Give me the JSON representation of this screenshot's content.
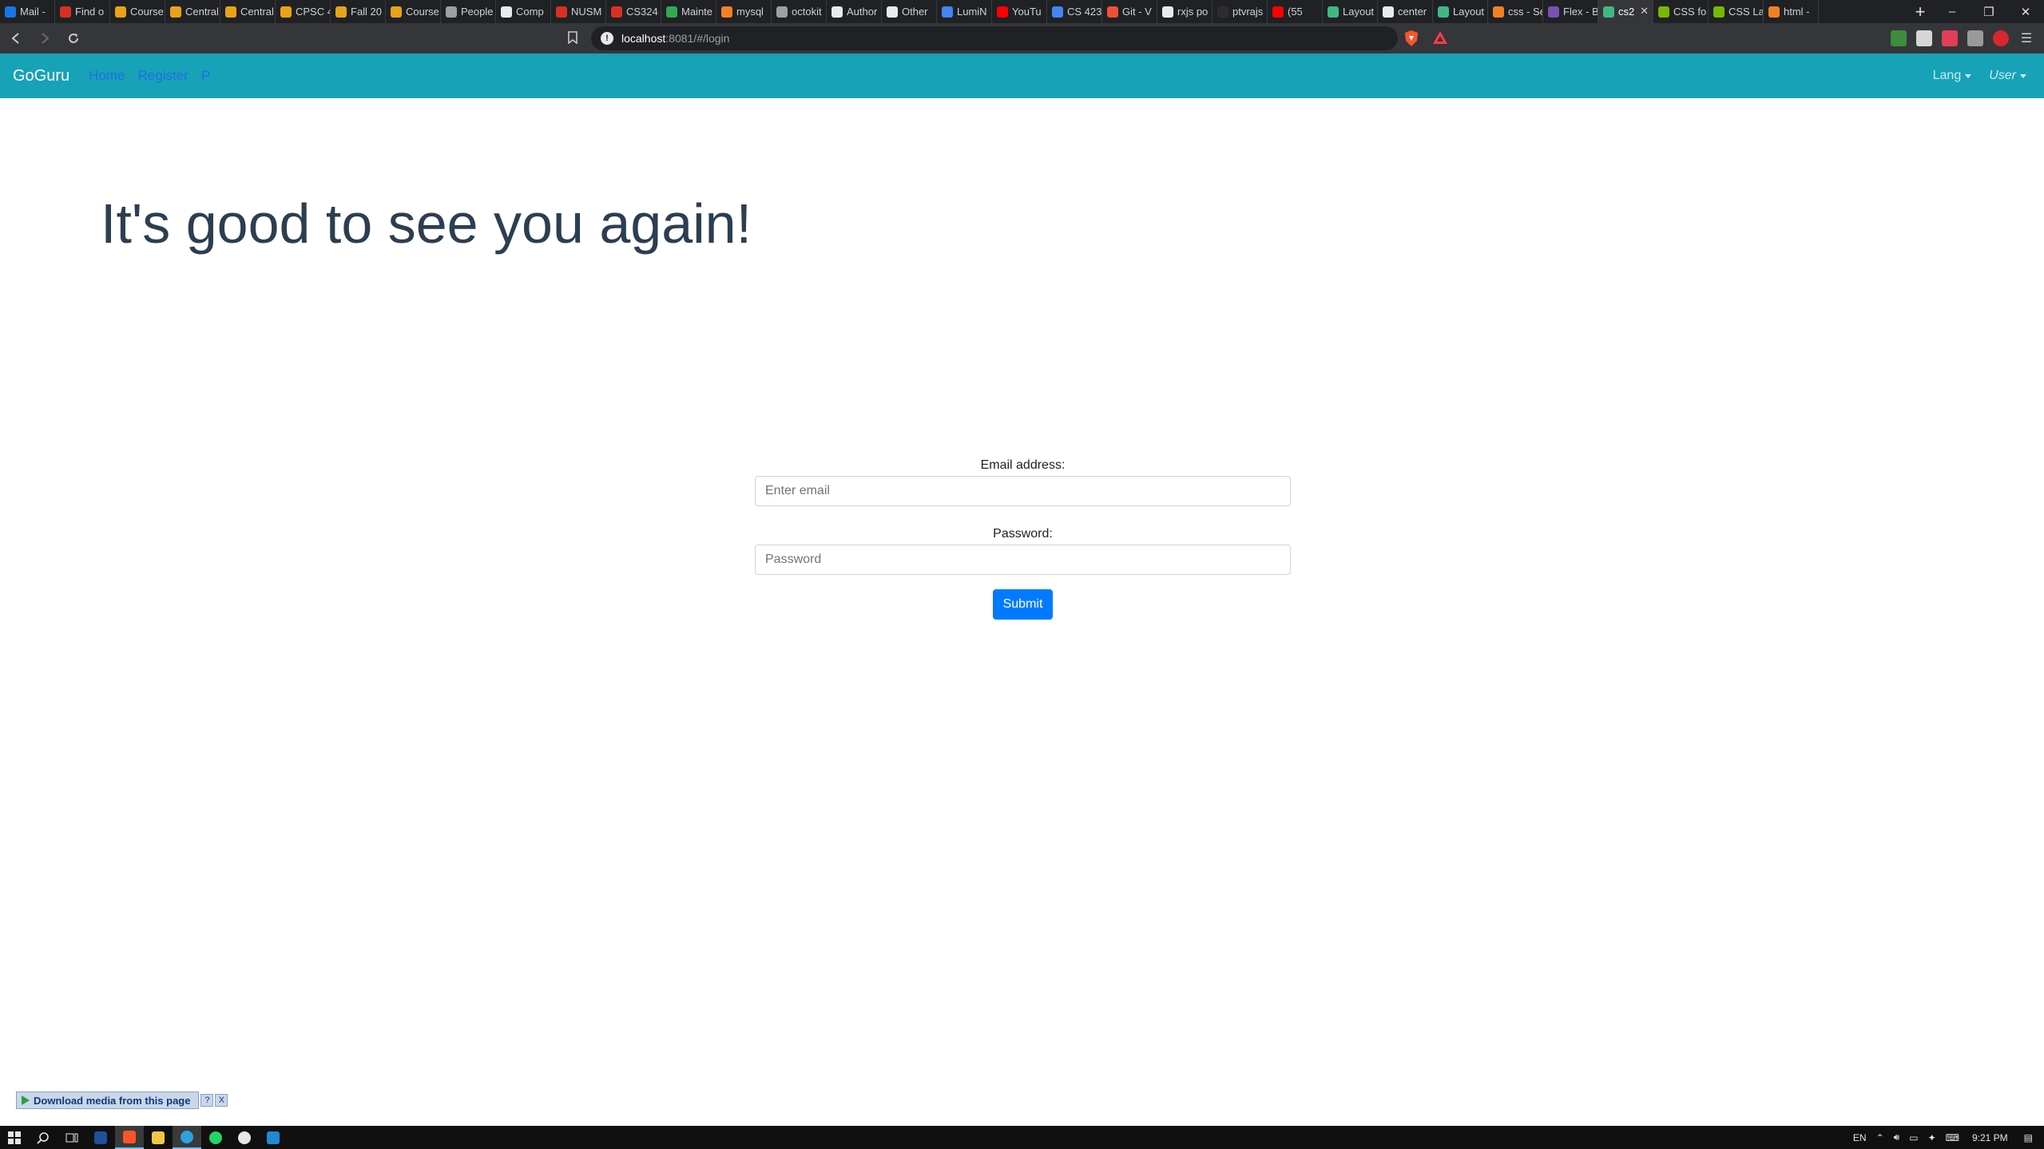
{
  "browser": {
    "tabs": [
      {
        "label": "Mail -",
        "color": "#1a73e8"
      },
      {
        "label": "Find o",
        "color": "#d93025"
      },
      {
        "label": "Course",
        "color": "#e8a317"
      },
      {
        "label": "Central",
        "color": "#e8a317"
      },
      {
        "label": "Central",
        "color": "#e8a317"
      },
      {
        "label": "CPSC 4",
        "color": "#e8a317"
      },
      {
        "label": "Fall 20",
        "color": "#e8a317"
      },
      {
        "label": "Course",
        "color": "#e8a317"
      },
      {
        "label": "People",
        "color": "#9aa0a6"
      },
      {
        "label": "Comp",
        "color": "#e8eaed"
      },
      {
        "label": "NUSM",
        "color": "#d93025"
      },
      {
        "label": "CS324",
        "color": "#d93025"
      },
      {
        "label": "Mainte",
        "color": "#34a853"
      },
      {
        "label": "mysql",
        "color": "#f48024"
      },
      {
        "label": "octokit",
        "color": "#9aa0a6"
      },
      {
        "label": "Author",
        "color": "#e8eaed"
      },
      {
        "label": "Other",
        "color": "#e8eaed"
      },
      {
        "label": "LumiN",
        "color": "#4285f4"
      },
      {
        "label": "YouTu",
        "color": "#ff0000"
      },
      {
        "label": "CS 423",
        "color": "#4285f4"
      },
      {
        "label": "Git - V",
        "color": "#f05133"
      },
      {
        "label": "rxjs po",
        "color": "#e8eaed"
      },
      {
        "label": "ptvrajs",
        "color": "#2d2d2d"
      },
      {
        "label": "(55",
        "color": "#ff0000"
      },
      {
        "label": "Layout",
        "color": "#41b883"
      },
      {
        "label": "center",
        "color": "#e8eaed"
      },
      {
        "label": "Layout",
        "color": "#41b883"
      },
      {
        "label": "css - Se",
        "color": "#f48024"
      },
      {
        "label": "Flex - B",
        "color": "#7952b3"
      },
      {
        "label": "cs2",
        "color": "#41b883"
      },
      {
        "label": "CSS fo",
        "color": "#76b900"
      },
      {
        "label": "CSS La",
        "color": "#76b900"
      },
      {
        "label": "html -",
        "color": "#f48024"
      }
    ],
    "active_tab_index": 29,
    "new_tab_symbol": "+",
    "url_host": "localhost",
    "url_path": ":8081/#/login",
    "window_controls": [
      "–",
      "❐",
      "✕"
    ]
  },
  "app": {
    "brand": "GoGuru",
    "nav_links": [
      "Home",
      "Register",
      "P"
    ],
    "lang_label": "Lang",
    "user_label": "User"
  },
  "hero": {
    "title": "It's good to see you again!"
  },
  "login": {
    "email_label": "Email address:",
    "email_placeholder": "Enter email",
    "password_label": "Password:",
    "password_placeholder": "Password",
    "submit_label": "Submit"
  },
  "download_widget": {
    "label": "Download media from this page",
    "help": "?",
    "close": "X"
  },
  "taskbar": {
    "language": "EN",
    "time": "9:21 PM"
  }
}
